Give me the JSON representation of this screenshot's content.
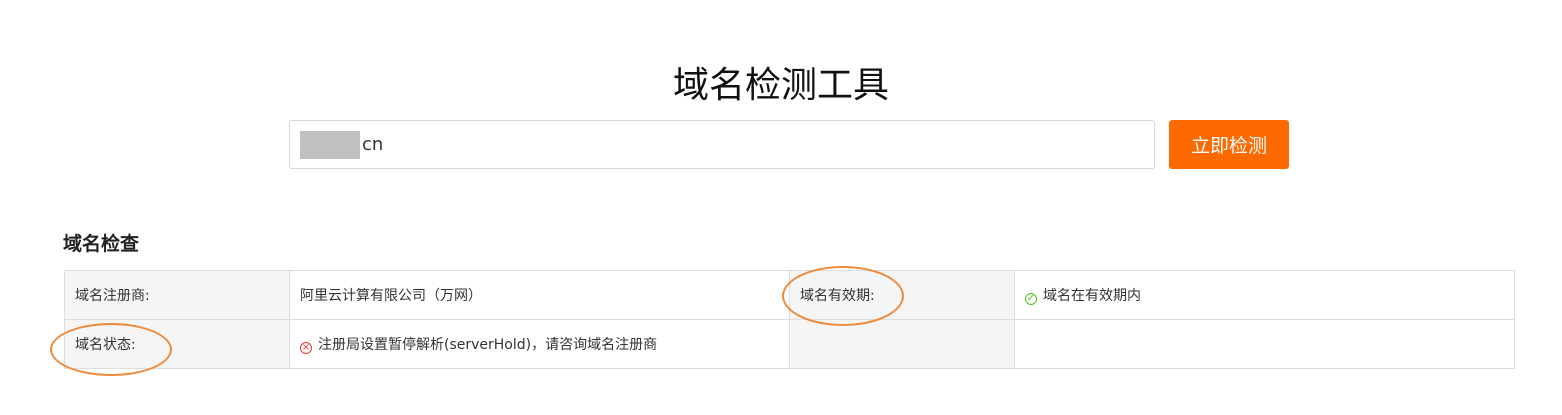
{
  "page": {
    "title": "域名检测工具"
  },
  "search": {
    "value": "cn",
    "button_label": "立即检测"
  },
  "section": {
    "title": "域名检查"
  },
  "table": {
    "registrar_label": "域名注册商:",
    "registrar_value": "阿里云计算有限公司（万网）",
    "validity_label": "域名有效期:",
    "validity_value": "域名在有效期内",
    "status_label": "域名状态:",
    "status_value": "注册局设置暂停解析(serverHold)，请咨询域名注册商"
  },
  "colors": {
    "accent": "#ff6a00",
    "success": "#52c41a",
    "error": "#e4393c",
    "annotation": "#ee8a3c"
  },
  "icons": {
    "validity_status": "check-circle-icon",
    "domain_status": "error-circle-icon"
  }
}
